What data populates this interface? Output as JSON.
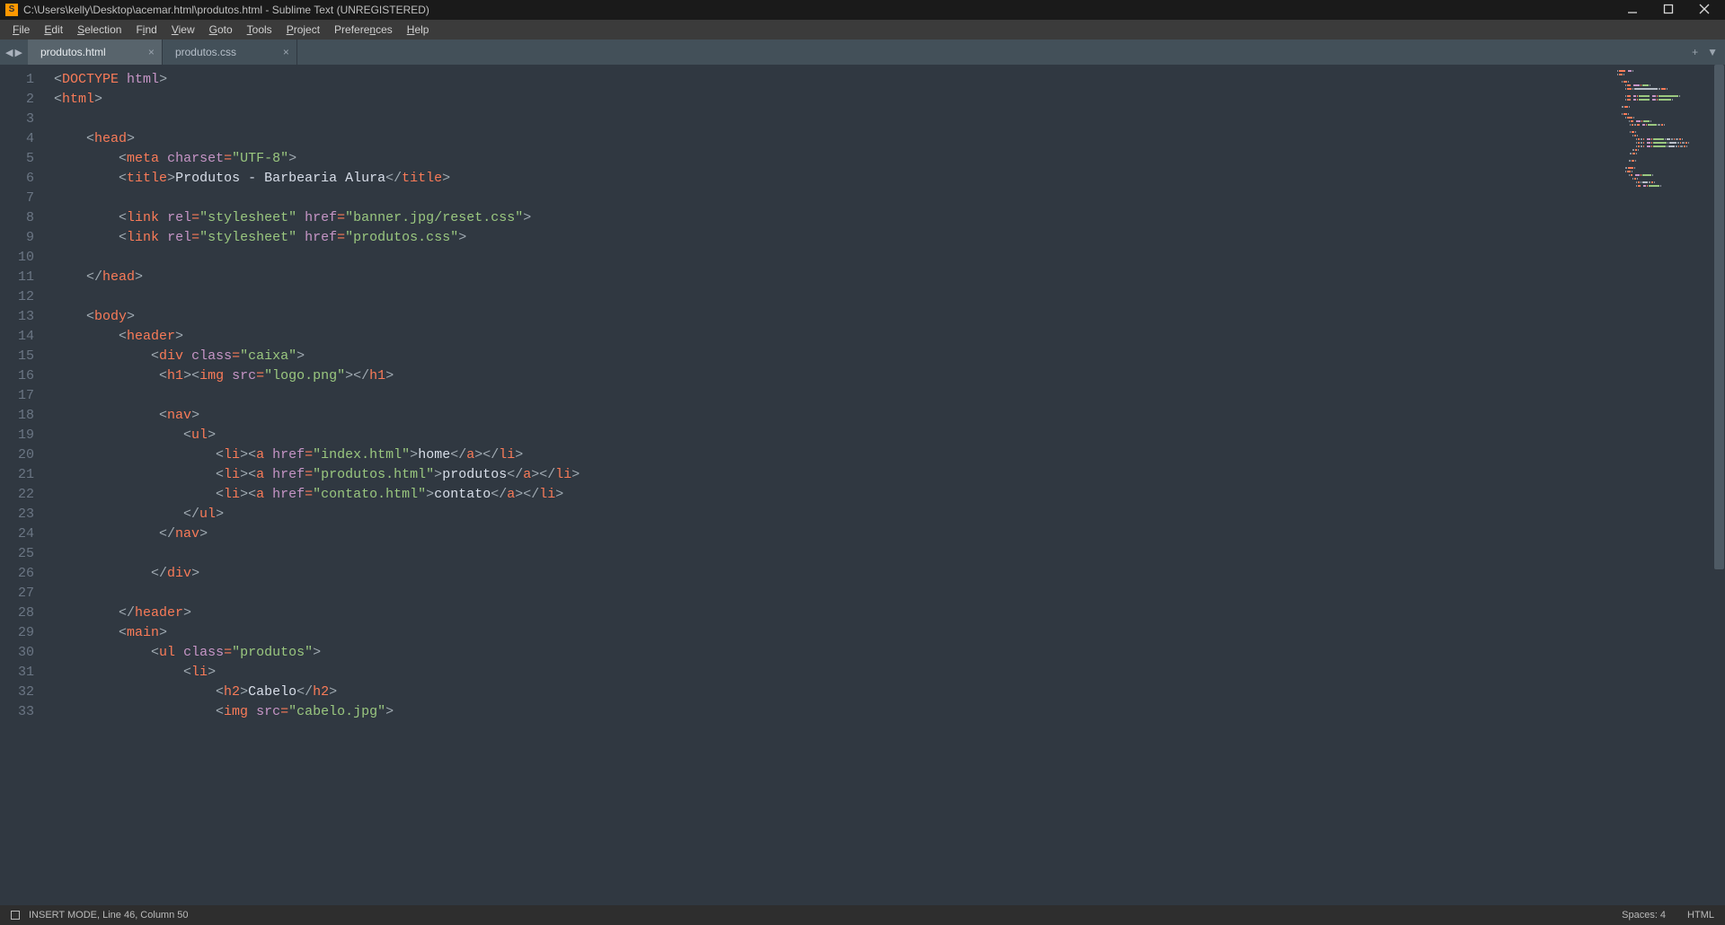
{
  "window_title": "C:\\Users\\kelly\\Desktop\\acemar.html\\produtos.html - Sublime Text (UNREGISTERED)",
  "app_icon_letter": "S",
  "menu": [
    {
      "label": "File",
      "mn": "F",
      "rest": "ile"
    },
    {
      "label": "Edit",
      "mn": "E",
      "rest": "dit"
    },
    {
      "label": "Selection",
      "mn": "S",
      "rest": "election"
    },
    {
      "label": "Find",
      "mn": "i",
      "pre": "F",
      "rest": "nd"
    },
    {
      "label": "View",
      "mn": "V",
      "rest": "iew"
    },
    {
      "label": "Goto",
      "mn": "G",
      "rest": "oto"
    },
    {
      "label": "Tools",
      "mn": "T",
      "rest": "ools"
    },
    {
      "label": "Project",
      "mn": "P",
      "rest": "roject"
    },
    {
      "label": "Preferences",
      "mn": "n",
      "pre": "Prefere",
      "rest": "ces"
    },
    {
      "label": "Help",
      "mn": "H",
      "rest": "elp"
    }
  ],
  "tabs": [
    {
      "name": "produtos.html",
      "active": true
    },
    {
      "name": "produtos.css",
      "active": false
    }
  ],
  "nav": {
    "back": "◀",
    "fwd": "▶"
  },
  "tab_controls": {
    "plus": "+",
    "menu": "▼"
  },
  "line_count": 33,
  "code_lines": [
    [
      {
        "t": "<",
        "k": "punct"
      },
      {
        "t": "DOCTYPE",
        "k": "tag"
      },
      {
        "t": " ",
        "k": "text"
      },
      {
        "t": "html",
        "k": "attr"
      },
      {
        "t": ">",
        "k": "punct"
      }
    ],
    [
      {
        "t": "<",
        "k": "punct"
      },
      {
        "t": "html",
        "k": "tag"
      },
      {
        "t": ">",
        "k": "punct"
      }
    ],
    [
      {
        "t": "",
        "k": "text"
      }
    ],
    [
      {
        "t": "    ",
        "k": "text"
      },
      {
        "t": "<",
        "k": "punct"
      },
      {
        "t": "head",
        "k": "tag"
      },
      {
        "t": ">",
        "k": "punct"
      }
    ],
    [
      {
        "t": "        ",
        "k": "text"
      },
      {
        "t": "<",
        "k": "punct"
      },
      {
        "t": "meta",
        "k": "tag"
      },
      {
        "t": " ",
        "k": "text"
      },
      {
        "t": "charset",
        "k": "attr"
      },
      {
        "t": "=",
        "k": "op"
      },
      {
        "t": "\"UTF-8\"",
        "k": "str"
      },
      {
        "t": ">",
        "k": "punct"
      }
    ],
    [
      {
        "t": "        ",
        "k": "text"
      },
      {
        "t": "<",
        "k": "punct"
      },
      {
        "t": "title",
        "k": "tag"
      },
      {
        "t": ">",
        "k": "punct"
      },
      {
        "t": "Produtos - Barbearia Alura",
        "k": "text"
      },
      {
        "t": "</",
        "k": "punct"
      },
      {
        "t": "title",
        "k": "tag"
      },
      {
        "t": ">",
        "k": "punct"
      }
    ],
    [
      {
        "t": "",
        "k": "text"
      }
    ],
    [
      {
        "t": "        ",
        "k": "text"
      },
      {
        "t": "<",
        "k": "punct"
      },
      {
        "t": "link",
        "k": "tag"
      },
      {
        "t": " ",
        "k": "text"
      },
      {
        "t": "rel",
        "k": "attr"
      },
      {
        "t": "=",
        "k": "op"
      },
      {
        "t": "\"stylesheet\"",
        "k": "str"
      },
      {
        "t": " ",
        "k": "text"
      },
      {
        "t": "href",
        "k": "attr"
      },
      {
        "t": "=",
        "k": "op"
      },
      {
        "t": "\"banner.jpg/reset.css\"",
        "k": "str"
      },
      {
        "t": ">",
        "k": "punct"
      }
    ],
    [
      {
        "t": "        ",
        "k": "text"
      },
      {
        "t": "<",
        "k": "punct"
      },
      {
        "t": "link",
        "k": "tag"
      },
      {
        "t": " ",
        "k": "text"
      },
      {
        "t": "rel",
        "k": "attr"
      },
      {
        "t": "=",
        "k": "op"
      },
      {
        "t": "\"stylesheet\"",
        "k": "str"
      },
      {
        "t": " ",
        "k": "text"
      },
      {
        "t": "href",
        "k": "attr"
      },
      {
        "t": "=",
        "k": "op"
      },
      {
        "t": "\"produtos.css\"",
        "k": "str"
      },
      {
        "t": ">",
        "k": "punct"
      }
    ],
    [
      {
        "t": "",
        "k": "text"
      }
    ],
    [
      {
        "t": "    ",
        "k": "text"
      },
      {
        "t": "</",
        "k": "punct"
      },
      {
        "t": "head",
        "k": "tag"
      },
      {
        "t": ">",
        "k": "punct"
      }
    ],
    [
      {
        "t": "",
        "k": "text"
      }
    ],
    [
      {
        "t": "    ",
        "k": "text"
      },
      {
        "t": "<",
        "k": "punct"
      },
      {
        "t": "body",
        "k": "tag"
      },
      {
        "t": ">",
        "k": "punct"
      }
    ],
    [
      {
        "t": "        ",
        "k": "text"
      },
      {
        "t": "<",
        "k": "punct"
      },
      {
        "t": "header",
        "k": "tag"
      },
      {
        "t": ">",
        "k": "punct"
      }
    ],
    [
      {
        "t": "            ",
        "k": "text"
      },
      {
        "t": "<",
        "k": "punct"
      },
      {
        "t": "div",
        "k": "tag"
      },
      {
        "t": " ",
        "k": "text"
      },
      {
        "t": "class",
        "k": "attr"
      },
      {
        "t": "=",
        "k": "op"
      },
      {
        "t": "\"caixa\"",
        "k": "str"
      },
      {
        "t": ">",
        "k": "punct"
      }
    ],
    [
      {
        "t": "             ",
        "k": "text"
      },
      {
        "t": "<",
        "k": "punct"
      },
      {
        "t": "h1",
        "k": "tag"
      },
      {
        "t": "><",
        "k": "punct"
      },
      {
        "t": "img",
        "k": "tag"
      },
      {
        "t": " ",
        "k": "text"
      },
      {
        "t": "src",
        "k": "attr"
      },
      {
        "t": "=",
        "k": "op"
      },
      {
        "t": "\"logo.png\"",
        "k": "str"
      },
      {
        "t": "></",
        "k": "punct"
      },
      {
        "t": "h1",
        "k": "tag"
      },
      {
        "t": ">",
        "k": "punct"
      }
    ],
    [
      {
        "t": "",
        "k": "text"
      }
    ],
    [
      {
        "t": "             ",
        "k": "text"
      },
      {
        "t": "<",
        "k": "punct"
      },
      {
        "t": "nav",
        "k": "tag"
      },
      {
        "t": ">",
        "k": "punct"
      }
    ],
    [
      {
        "t": "                ",
        "k": "text"
      },
      {
        "t": "<",
        "k": "punct"
      },
      {
        "t": "ul",
        "k": "tag"
      },
      {
        "t": ">",
        "k": "punct"
      }
    ],
    [
      {
        "t": "                    ",
        "k": "text"
      },
      {
        "t": "<",
        "k": "punct"
      },
      {
        "t": "li",
        "k": "tag"
      },
      {
        "t": "><",
        "k": "punct"
      },
      {
        "t": "a",
        "k": "tag"
      },
      {
        "t": " ",
        "k": "text"
      },
      {
        "t": "href",
        "k": "attr"
      },
      {
        "t": "=",
        "k": "op"
      },
      {
        "t": "\"index.html\"",
        "k": "str"
      },
      {
        "t": ">",
        "k": "punct"
      },
      {
        "t": "home",
        "k": "text"
      },
      {
        "t": "</",
        "k": "punct"
      },
      {
        "t": "a",
        "k": "tag"
      },
      {
        "t": "></",
        "k": "punct"
      },
      {
        "t": "li",
        "k": "tag"
      },
      {
        "t": ">",
        "k": "punct"
      }
    ],
    [
      {
        "t": "                    ",
        "k": "text"
      },
      {
        "t": "<",
        "k": "punct"
      },
      {
        "t": "li",
        "k": "tag"
      },
      {
        "t": "><",
        "k": "punct"
      },
      {
        "t": "a",
        "k": "tag"
      },
      {
        "t": " ",
        "k": "text"
      },
      {
        "t": "href",
        "k": "attr"
      },
      {
        "t": "=",
        "k": "op"
      },
      {
        "t": "\"produtos.html\"",
        "k": "str"
      },
      {
        "t": ">",
        "k": "punct"
      },
      {
        "t": "produtos",
        "k": "text"
      },
      {
        "t": "</",
        "k": "punct"
      },
      {
        "t": "a",
        "k": "tag"
      },
      {
        "t": "></",
        "k": "punct"
      },
      {
        "t": "li",
        "k": "tag"
      },
      {
        "t": ">",
        "k": "punct"
      }
    ],
    [
      {
        "t": "                    ",
        "k": "text"
      },
      {
        "t": "<",
        "k": "punct"
      },
      {
        "t": "li",
        "k": "tag"
      },
      {
        "t": "><",
        "k": "punct"
      },
      {
        "t": "a",
        "k": "tag"
      },
      {
        "t": " ",
        "k": "text"
      },
      {
        "t": "href",
        "k": "attr"
      },
      {
        "t": "=",
        "k": "op"
      },
      {
        "t": "\"contato.html\"",
        "k": "str"
      },
      {
        "t": ">",
        "k": "punct"
      },
      {
        "t": "contato",
        "k": "text"
      },
      {
        "t": "</",
        "k": "punct"
      },
      {
        "t": "a",
        "k": "tag"
      },
      {
        "t": "></",
        "k": "punct"
      },
      {
        "t": "li",
        "k": "tag"
      },
      {
        "t": ">",
        "k": "punct"
      }
    ],
    [
      {
        "t": "                ",
        "k": "text"
      },
      {
        "t": "</",
        "k": "punct"
      },
      {
        "t": "ul",
        "k": "tag"
      },
      {
        "t": ">",
        "k": "punct"
      }
    ],
    [
      {
        "t": "             ",
        "k": "text"
      },
      {
        "t": "</",
        "k": "punct"
      },
      {
        "t": "nav",
        "k": "tag"
      },
      {
        "t": ">",
        "k": "punct"
      }
    ],
    [
      {
        "t": "",
        "k": "text"
      }
    ],
    [
      {
        "t": "            ",
        "k": "text"
      },
      {
        "t": "</",
        "k": "punct"
      },
      {
        "t": "div",
        "k": "tag"
      },
      {
        "t": ">",
        "k": "punct"
      }
    ],
    [
      {
        "t": "",
        "k": "text"
      }
    ],
    [
      {
        "t": "        ",
        "k": "text"
      },
      {
        "t": "</",
        "k": "punct"
      },
      {
        "t": "header",
        "k": "tag"
      },
      {
        "t": ">",
        "k": "punct"
      }
    ],
    [
      {
        "t": "        ",
        "k": "text"
      },
      {
        "t": "<",
        "k": "punct"
      },
      {
        "t": "main",
        "k": "tag"
      },
      {
        "t": ">",
        "k": "punct"
      }
    ],
    [
      {
        "t": "            ",
        "k": "text"
      },
      {
        "t": "<",
        "k": "punct"
      },
      {
        "t": "ul",
        "k": "tag"
      },
      {
        "t": " ",
        "k": "text"
      },
      {
        "t": "class",
        "k": "attr"
      },
      {
        "t": "=",
        "k": "op"
      },
      {
        "t": "\"produtos\"",
        "k": "str"
      },
      {
        "t": ">",
        "k": "punct"
      }
    ],
    [
      {
        "t": "                ",
        "k": "text"
      },
      {
        "t": "<",
        "k": "punct"
      },
      {
        "t": "li",
        "k": "tag"
      },
      {
        "t": ">",
        "k": "punct"
      }
    ],
    [
      {
        "t": "                    ",
        "k": "text"
      },
      {
        "t": "<",
        "k": "punct"
      },
      {
        "t": "h2",
        "k": "tag"
      },
      {
        "t": ">",
        "k": "punct"
      },
      {
        "t": "Cabelo",
        "k": "text"
      },
      {
        "t": "</",
        "k": "punct"
      },
      {
        "t": "h2",
        "k": "tag"
      },
      {
        "t": ">",
        "k": "punct"
      }
    ],
    [
      {
        "t": "                    ",
        "k": "text"
      },
      {
        "t": "<",
        "k": "punct"
      },
      {
        "t": "img",
        "k": "tag"
      },
      {
        "t": " ",
        "k": "text"
      },
      {
        "t": "src",
        "k": "attr"
      },
      {
        "t": "=",
        "k": "op"
      },
      {
        "t": "\"cabelo.jpg\"",
        "k": "str"
      },
      {
        "t": ">",
        "k": "punct"
      }
    ]
  ],
  "status": {
    "left": "INSERT MODE, Line 46, Column 50",
    "spaces": "Spaces: 4",
    "syntax": "HTML"
  }
}
